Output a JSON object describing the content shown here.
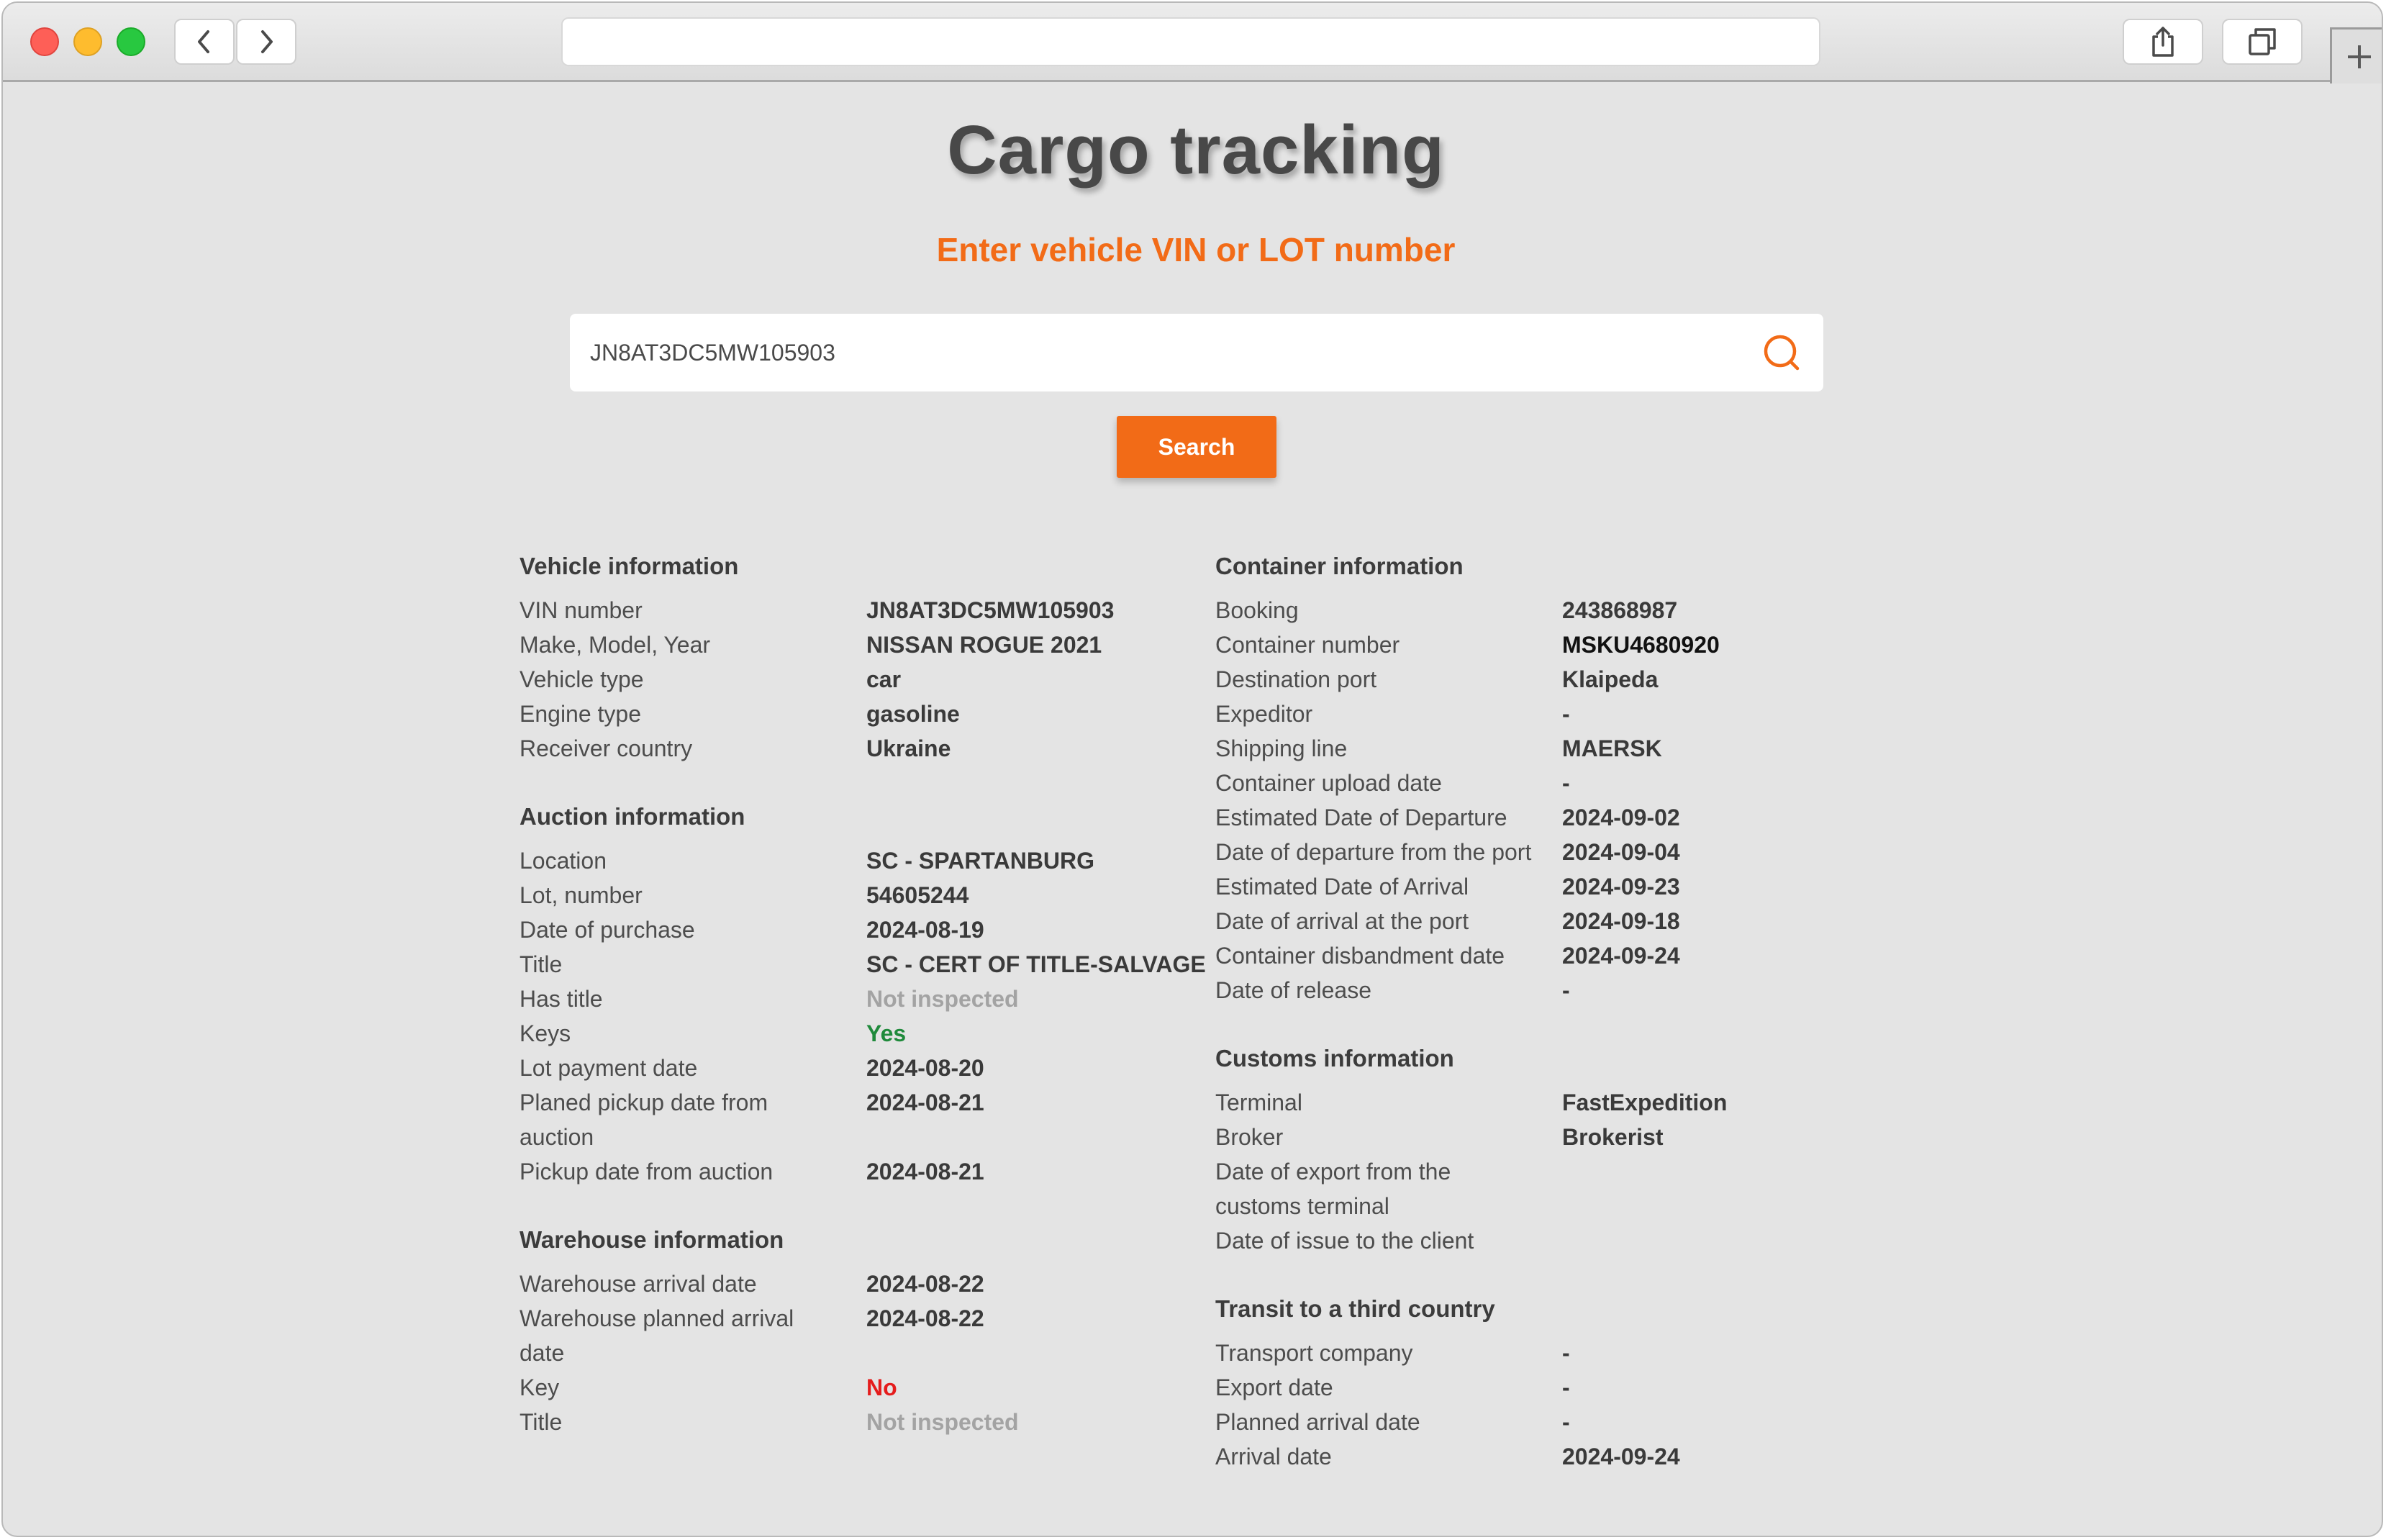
{
  "browser": {
    "url": "",
    "icons": [
      "back-chevron-icon",
      "forward-chevron-icon",
      "share-icon",
      "tabs-icon",
      "plus-icon"
    ]
  },
  "page": {
    "title": "Cargo tracking",
    "subtitle": "Enter vehicle VIN or LOT number",
    "search_value": "JN8AT3DC5MW105903",
    "search_button": "Search"
  },
  "colors": {
    "accent": "#f26b17",
    "yes": "#1f8a3b",
    "no": "#e51c1c",
    "muted": "#a3a3a3",
    "background": "#e4e4e4"
  },
  "left_sections": [
    {
      "title": "Vehicle information",
      "rows": [
        {
          "label": "VIN number",
          "value": "JN8AT3DC5MW105903"
        },
        {
          "label": "Make, Model, Year",
          "value": "NISSAN ROGUE 2021"
        },
        {
          "label": "Vehicle type",
          "value": "car"
        },
        {
          "label": "Engine type",
          "value": "gasoline"
        },
        {
          "label": "Receiver country",
          "value": "Ukraine"
        }
      ]
    },
    {
      "title": "Auction information",
      "rows": [
        {
          "label": "Location",
          "value": "SC - SPARTANBURG"
        },
        {
          "label": "Lot, number",
          "value": "54605244"
        },
        {
          "label": "Date of purchase",
          "value": "2024-08-19"
        },
        {
          "label": "Title",
          "value": "SC - CERT OF TITLE-SALVAGE"
        },
        {
          "label": "Has title",
          "value": "Not inspected"
        },
        {
          "label": "Keys",
          "value": "Yes"
        },
        {
          "label": "Lot payment date",
          "value": "2024-08-20"
        },
        {
          "label": "Planed pickup date from auction",
          "value": "2024-08-21"
        },
        {
          "label": "Pickup date from auction",
          "value": "2024-08-21"
        }
      ]
    },
    {
      "title": "Warehouse information",
      "rows": [
        {
          "label": "Warehouse arrival date",
          "value": "2024-08-22"
        },
        {
          "label": "Warehouse planned arrival date",
          "value": "2024-08-22"
        },
        {
          "label": "Key",
          "value": "No"
        },
        {
          "label": "Title",
          "value": "Not inspected"
        }
      ]
    }
  ],
  "right_sections": [
    {
      "title": "Container information",
      "rows": [
        {
          "label": "Booking",
          "value": "243868987"
        },
        {
          "label": "Container number",
          "value": "MSKU4680920"
        },
        {
          "label": "Destination port",
          "value": "Klaipeda"
        },
        {
          "label": "Expeditor",
          "value": "-"
        },
        {
          "label": "Shipping line",
          "value": "MAERSK"
        },
        {
          "label": "Container upload date",
          "value": "-"
        },
        {
          "label": "Estimated Date of Departure",
          "value": "2024-09-02"
        },
        {
          "label": "Date of departure from the port",
          "value": "2024-09-04"
        },
        {
          "label": "Estimated Date of Arrival",
          "value": "2024-09-23"
        },
        {
          "label": "Date of arrival at the port",
          "value": "2024-09-18"
        },
        {
          "label": "Container disbandment date",
          "value": "2024-09-24"
        },
        {
          "label": "Date of release",
          "value": "-"
        }
      ]
    },
    {
      "title": "Customs information",
      "rows": [
        {
          "label": "Terminal",
          "value": "FastExpedition"
        },
        {
          "label": "Broker",
          "value": "Brokerist"
        },
        {
          "label": "Date of export from the customs terminal",
          "value": ""
        },
        {
          "label": "Date of issue to the client",
          "value": ""
        }
      ]
    },
    {
      "title": "Transit to a third country",
      "rows": [
        {
          "label": "Transport company",
          "value": "-"
        },
        {
          "label": "Export date",
          "value": "-"
        },
        {
          "label": "Planned arrival date",
          "value": "-"
        },
        {
          "label": "Arrival date",
          "value": "2024-09-24"
        }
      ]
    }
  ]
}
